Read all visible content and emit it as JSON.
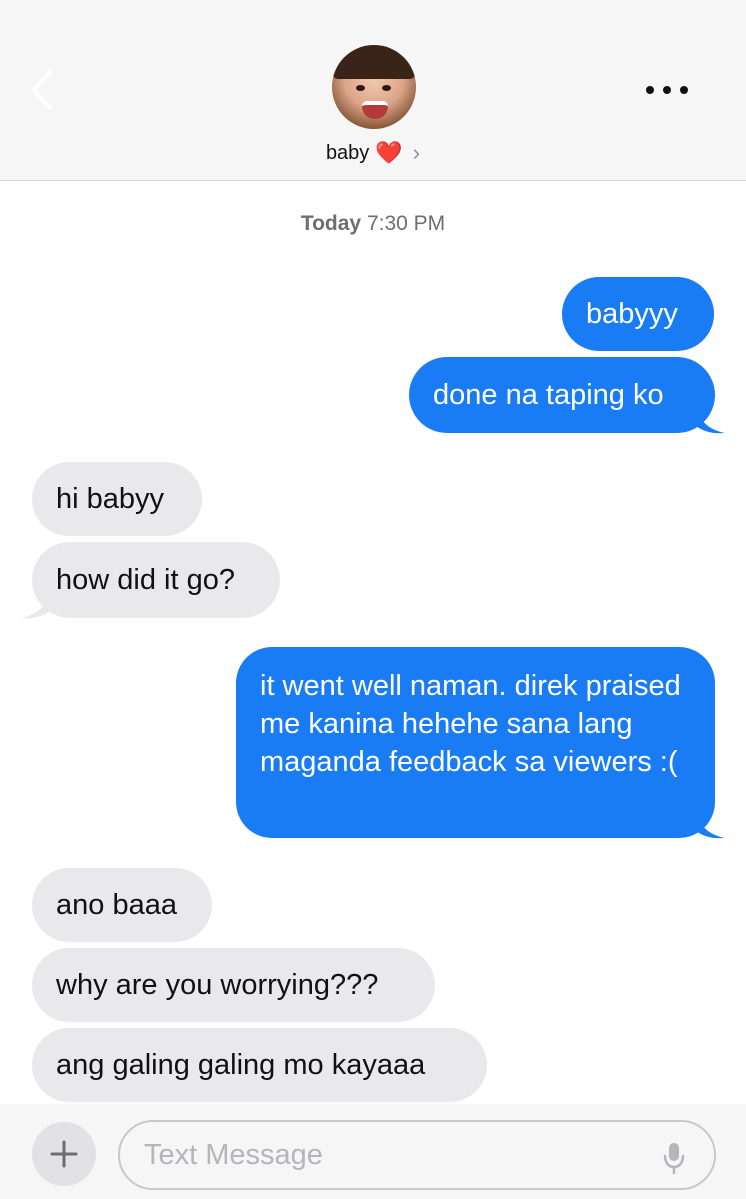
{
  "header": {
    "contact_name": "baby",
    "contact_emoji": "❤️",
    "chevron": "›",
    "back_icon": "chevron-left-icon",
    "more_icon": "more-dots-icon"
  },
  "timestamp": {
    "day": "Today",
    "time": "7:30 PM"
  },
  "messages": [
    {
      "from": "me",
      "text": "babyyy"
    },
    {
      "from": "me",
      "text": "done na taping ko"
    },
    {
      "from": "them",
      "text": "hi babyy"
    },
    {
      "from": "them",
      "text": "how did it go?"
    },
    {
      "from": "me",
      "text": "it went well naman. direk praised me kanina hehehe sana lang maganda feedback sa viewers :("
    },
    {
      "from": "them",
      "text": "ano baaa"
    },
    {
      "from": "them",
      "text": "why are you worrying???"
    },
    {
      "from": "them",
      "text": "ang galing galing mo kayaaa"
    }
  ],
  "composer": {
    "placeholder": "Text Message",
    "plus_icon": "plus-icon",
    "mic_icon": "microphone-icon"
  },
  "colors": {
    "sent_bubble": "#1a7cf5",
    "received_bubble": "#e9e9eb",
    "header_bg": "#f6f6f6"
  }
}
